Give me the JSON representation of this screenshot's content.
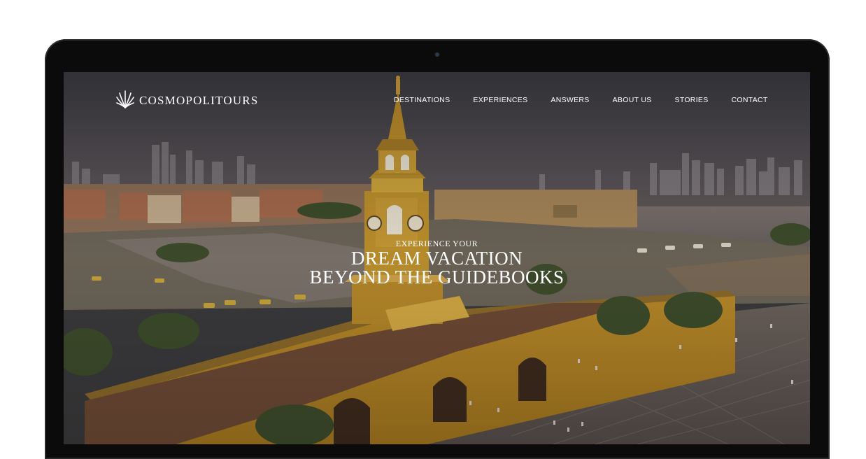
{
  "header": {
    "brand": "COSMOPOLITOURS",
    "nav": [
      {
        "label": "DESTINATIONS"
      },
      {
        "label": "EXPERIENCES"
      },
      {
        "label": "ANSWERS"
      },
      {
        "label": "ABOUT US"
      },
      {
        "label": "STORIES"
      },
      {
        "label": "CONTACT"
      }
    ]
  },
  "hero": {
    "kicker": "EXPERIENCE YOUR",
    "line1": "DREAM VACATION",
    "line2": "BEYOND THE GUIDEBOOKS"
  },
  "colors": {
    "bezel": "#0b0b0c",
    "text": "#ffffff",
    "wall": "#c6992e",
    "sky": "#4a4a52"
  }
}
